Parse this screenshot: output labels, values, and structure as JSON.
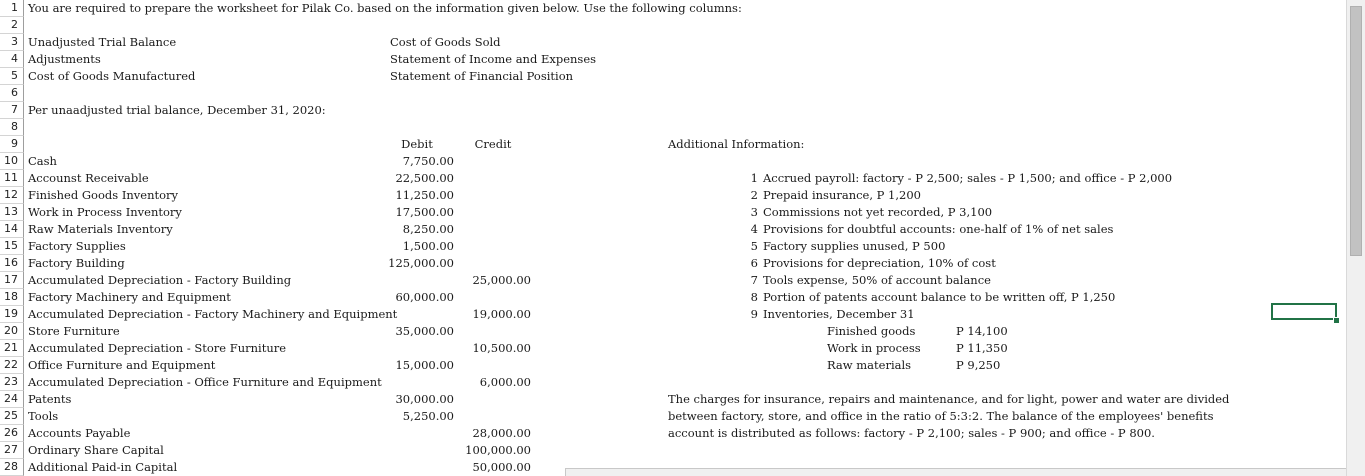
{
  "rows": [
    {
      "n": "1",
      "a": "You are required to prepare the worksheet for Pilak Co. based on the information given below. Use the following columns:"
    },
    {
      "n": "2"
    },
    {
      "n": "3",
      "a": "Unadjusted Trial Balance",
      "e": "Cost of Goods Sold"
    },
    {
      "n": "4",
      "a": "Adjustments",
      "e": "Statement of Income and Expenses"
    },
    {
      "n": "5",
      "a": "Cost of Goods Manufactured",
      "e": "Statement of Financial Position"
    },
    {
      "n": "6"
    },
    {
      "n": "7",
      "a": "Per unaadjusted trial balance, December 31, 2020:"
    },
    {
      "n": "8"
    },
    {
      "n": "9",
      "debit": "Debit",
      "credit": "Credit",
      "info": "Additional Information:"
    },
    {
      "n": "10",
      "a": "Cash",
      "debit": "7,750.00"
    },
    {
      "n": "11",
      "a": "Accounst Receivable",
      "debit": "22,500.00",
      "inum": "1",
      "itext": "Accrued payroll: factory - P 2,500; sales - P 1,500; and office - P 2,000"
    },
    {
      "n": "12",
      "a": "Finished Goods Inventory",
      "debit": "11,250.00",
      "inum": "2",
      "itext": "Prepaid insurance, P 1,200"
    },
    {
      "n": "13",
      "a": "Work in Process Inventory",
      "debit": "17,500.00",
      "inum": "3",
      "itext": "Commissions not yet recorded, P 3,100"
    },
    {
      "n": "14",
      "a": "Raw Materials Inventory",
      "debit": "8,250.00",
      "inum": "4",
      "itext": "Provisions for doubtful accounts: one-half of 1% of net sales"
    },
    {
      "n": "15",
      "a": "Factory Supplies",
      "debit": "1,500.00",
      "inum": "5",
      "itext": "Factory supplies unused, P 500"
    },
    {
      "n": "16",
      "a": "Factory Building",
      "debit": "125,000.00",
      "inum": "6",
      "itext": "Provisions for depreciation, 10% of cost"
    },
    {
      "n": "17",
      "a": "Accumulated Depreciation - Factory Building",
      "credit": "25,000.00",
      "inum": "7",
      "itext": "Tools expense, 50% of account balance"
    },
    {
      "n": "18",
      "a": "Factory Machinery and Equipment",
      "debit": "60,000.00",
      "inum": "8",
      "itext": "Portion of patents account balance to be written off, P 1,250"
    },
    {
      "n": "19",
      "a": "Accumulated Depreciation - Factory Machinery and Equipment",
      "credit": "19,000.00",
      "inum": "9",
      "itext": "Inventories, December 31"
    },
    {
      "n": "20",
      "a": "Store Furniture",
      "debit": "35,000.00",
      "invlabel": "Finished goods",
      "invval": "P 14,100"
    },
    {
      "n": "21",
      "a": "Accumulated Depreciation - Store Furniture",
      "credit": "10,500.00",
      "invlabel": "Work in process",
      "invval": "P 11,350"
    },
    {
      "n": "22",
      "a": "Office Furniture and Equipment",
      "debit": "15,000.00",
      "invlabel": "Raw materials",
      "invval": "P 9,250"
    },
    {
      "n": "23",
      "a": "Accumulated Depreciation - Office Furniture and Equipment",
      "credit": "6,000.00"
    },
    {
      "n": "24",
      "a": "Patents",
      "debit": "30,000.00",
      "info": "The charges for insurance, repairs and maintenance, and for light, power and water are divided"
    },
    {
      "n": "25",
      "a": "Tools",
      "debit": "5,250.00",
      "info": "between factory, store, and office in the ratio of 5:3:2. The balance of the employees' benefits"
    },
    {
      "n": "26",
      "a": "Accounts Payable",
      "credit": "28,000.00",
      "info": "account is distributed as follows: factory - P 2,100; sales - P 900; and office - P 800."
    },
    {
      "n": "27",
      "a": "Ordinary Share Capital",
      "credit": "100,000.00"
    },
    {
      "n": "28",
      "a": "Additional Paid-in Capital",
      "credit": "50,000.00"
    }
  ]
}
